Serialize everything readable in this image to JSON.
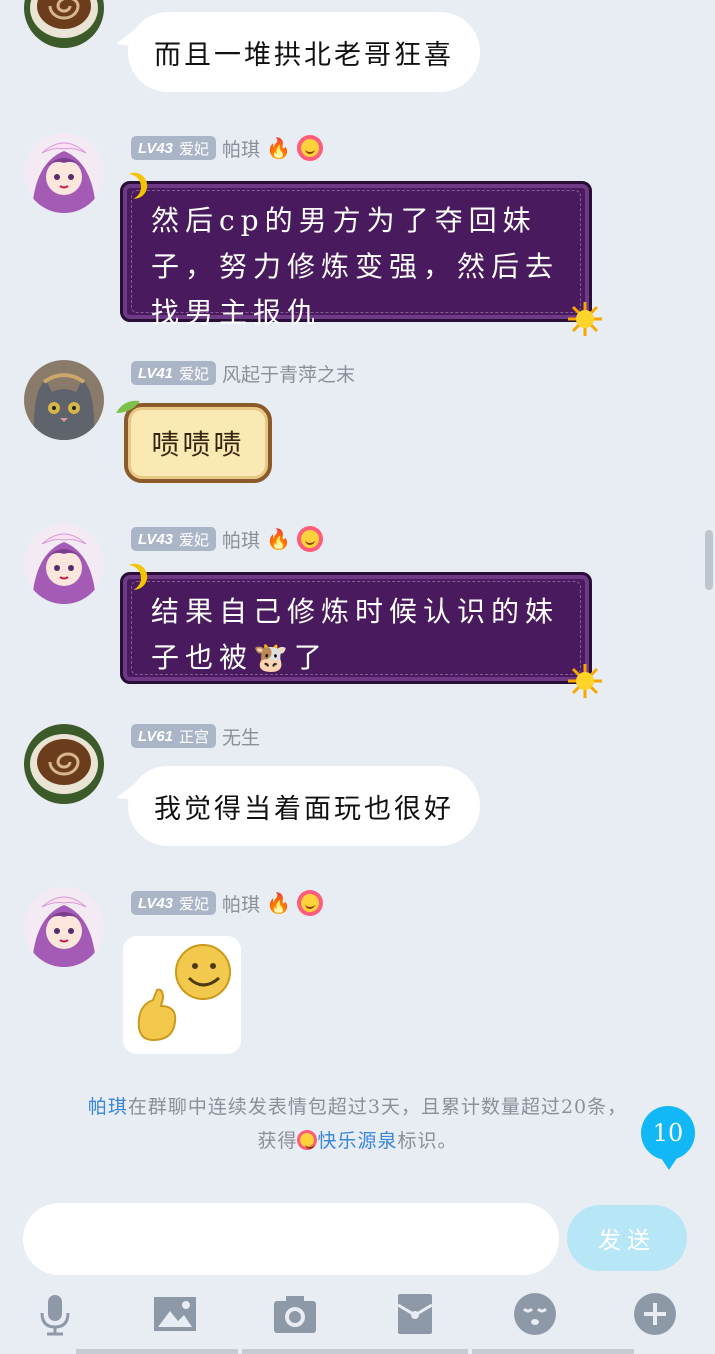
{
  "messages": [
    {
      "user": "",
      "text": "而且一堆拱北老哥狂喜"
    },
    {
      "level": "LV43",
      "title": "爱妃",
      "user": "帕琪",
      "text_lines": [
        "然后cp的男方为了夺回妹",
        "子，努力修炼变强，然后去",
        "找男主报仇"
      ]
    },
    {
      "level": "LV41",
      "title": "爱妃",
      "user": "风起于青萍之末",
      "text": "啧啧啧"
    },
    {
      "level": "LV43",
      "title": "爱妃",
      "user": "帕琪",
      "text_line1": "结果自己修炼时候认识的妹",
      "text_line2a": "子也被",
      "text_line2b": "了",
      "emoji": "🐮"
    },
    {
      "level": "LV61",
      "title": "正宫",
      "user": "无生",
      "text": "我觉得当着面玩也很好"
    },
    {
      "level": "LV43",
      "title": "爱妃",
      "user": "帕琪",
      "sticker": "smiley-thumbs-up-sticker"
    }
  ],
  "system_notice": {
    "name": "帕琪",
    "line1_rest": "在群聊中连续发表情包超过3天，且累计数量超过20条，",
    "line2_prefix": "获得",
    "badge_name": "快乐源泉",
    "line2_suffix": "标识。"
  },
  "icons": {
    "flame": "🔥"
  },
  "unread_count": "10",
  "composer": {
    "placeholder": "",
    "send_label": "发送"
  },
  "toolbar": [
    "microphone-icon",
    "image-icon",
    "camera-icon",
    "red-packet-icon",
    "emoji-icon",
    "plus-icon"
  ],
  "colors": {
    "accent": "#12b7f5",
    "link": "#3a86d8",
    "purple_bubble": "#4a1a5e",
    "send_disabled": "#b7e6f6"
  }
}
